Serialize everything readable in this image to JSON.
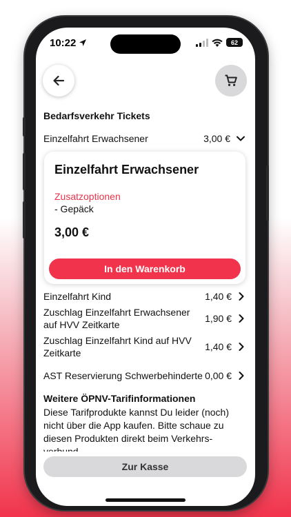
{
  "status": {
    "time": "10:22",
    "battery": "62"
  },
  "section_title": "Bedarfsverkehr Tickets",
  "tickets": [
    {
      "label": "Einzelfahrt Erwachsener",
      "price": "3,00 €"
    },
    {
      "label": "Einzelfahrt Kind",
      "price": "1,40 €"
    },
    {
      "label": "Zuschlag Einzelfahrt Erwachsener auf HVV Zeitkarte",
      "price": "1,90 €"
    },
    {
      "label": "Zuschlag Einzelfahrt Kind auf HVV Zeitkarte",
      "price": "1,40 €"
    },
    {
      "label": "AST Reservierung Schwerbehinderte",
      "price": "0,00 €"
    }
  ],
  "detail_card": {
    "title": "Einzelfahrt Erwachsener",
    "options_title": "Zusatzoptionen",
    "option_item": "- Gepäck",
    "price": "3,00 €",
    "add_button": "In den Warenkorb"
  },
  "info": {
    "title": "Weitere ÖPNV-Tarifinformationen",
    "text": "Diese Tarifprodukte kannst Du leider (noch) nicht über die App kaufen. Bitte schaue zu diesen Produkten direkt beim Verkehrs­verbund"
  },
  "checkout_button": "Zur Kasse",
  "colors": {
    "accent": "#f1344c",
    "options_title": "#e8334a",
    "disabled_button": "#d9d9db"
  }
}
